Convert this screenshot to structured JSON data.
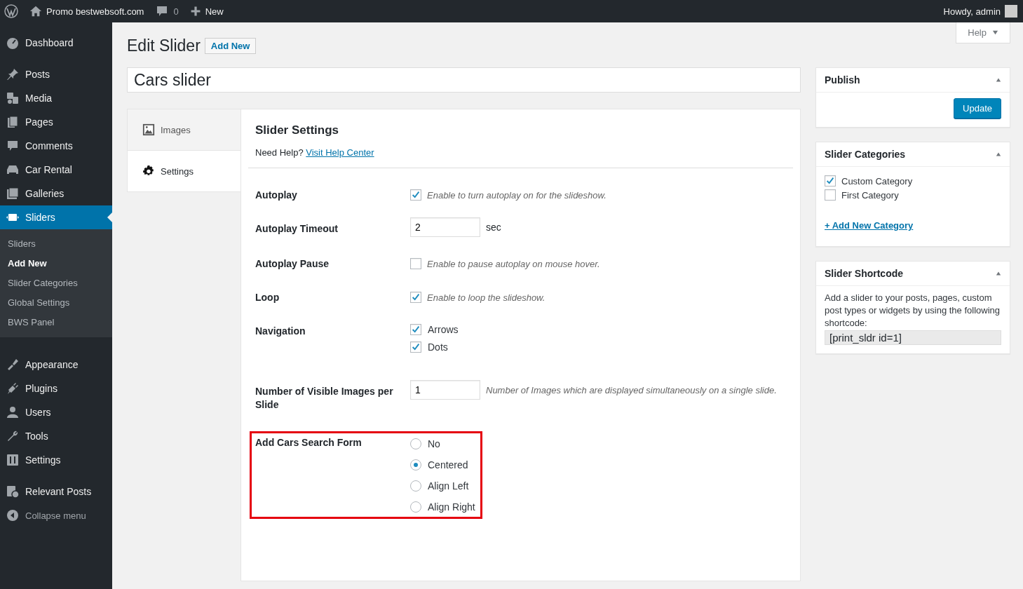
{
  "admin_bar": {
    "site_name": "Promo bestwebsoft.com",
    "comments_count": "0",
    "new_label": "New",
    "greeting": "Howdy, admin"
  },
  "sidebar": {
    "items": [
      {
        "label": "Dashboard",
        "kind": "dashboard",
        "selected": false
      },
      {
        "label": "Posts",
        "kind": "posts",
        "selected": false
      },
      {
        "label": "Media",
        "kind": "media",
        "selected": false
      },
      {
        "label": "Pages",
        "kind": "pages",
        "selected": false
      },
      {
        "label": "Comments",
        "kind": "comments",
        "selected": false
      },
      {
        "label": "Car Rental",
        "kind": "car",
        "selected": false
      },
      {
        "label": "Galleries",
        "kind": "gallery",
        "selected": false
      },
      {
        "label": "Sliders",
        "kind": "slider",
        "selected": true
      },
      {
        "label": "Appearance",
        "kind": "appearance",
        "selected": false
      },
      {
        "label": "Plugins",
        "kind": "plugins",
        "selected": false
      },
      {
        "label": "Users",
        "kind": "users",
        "selected": false
      },
      {
        "label": "Tools",
        "kind": "tools",
        "selected": false
      },
      {
        "label": "Settings",
        "kind": "settings",
        "selected": false
      },
      {
        "label": "Relevant Posts",
        "kind": "relevant",
        "selected": false
      }
    ],
    "submenu": [
      {
        "label": "Sliders",
        "selected": false
      },
      {
        "label": "Add New",
        "selected": true
      },
      {
        "label": "Slider Categories",
        "selected": false
      },
      {
        "label": "Global Settings",
        "selected": false
      },
      {
        "label": "BWS Panel",
        "selected": false
      }
    ],
    "collapse_label": "Collapse menu"
  },
  "help_button": "Help",
  "page": {
    "title": "Edit Slider",
    "add_new": "Add New",
    "slider_title": "Cars slider"
  },
  "tabs": [
    {
      "label": "Images",
      "kind": "images",
      "selected": false
    },
    {
      "label": "Settings",
      "kind": "settings",
      "selected": true
    }
  ],
  "settings": {
    "title": "Slider Settings",
    "help_prefix": "Need Help?",
    "help_link": "Visit Help Center",
    "rows": [
      {
        "kind": "checkbox",
        "label": "Autoplay",
        "checked": true,
        "description": "Enable to turn autoplay on for the slideshow."
      },
      {
        "kind": "number",
        "label": "Autoplay Timeout",
        "value": "2",
        "unit": "sec"
      },
      {
        "kind": "checkbox",
        "label": "Autoplay Pause",
        "checked": false,
        "description": "Enable to pause autoplay on mouse hover."
      },
      {
        "kind": "checkbox",
        "label": "Loop",
        "checked": true,
        "description": "Enable to loop the slideshow."
      },
      {
        "kind": "checkboxes",
        "label": "Navigation",
        "options": [
          {
            "label": "Arrows",
            "checked": true
          },
          {
            "label": "Dots",
            "checked": true
          }
        ]
      },
      {
        "kind": "number",
        "label": "Number of Visible Images per Slide",
        "value": "1",
        "description": "Number of Images which are displayed simultaneously on a single slide."
      },
      {
        "kind": "radio",
        "label": "Add Cars Search Form",
        "highlighted": true,
        "options": [
          {
            "label": "No",
            "selected": false
          },
          {
            "label": "Centered",
            "selected": true
          },
          {
            "label": "Align Left",
            "selected": false
          },
          {
            "label": "Align Right",
            "selected": false
          }
        ]
      }
    ]
  },
  "publish": {
    "title": "Publish",
    "button": "Update"
  },
  "categories": {
    "title": "Slider Categories",
    "items": [
      {
        "label": "Custom Category",
        "checked": true
      },
      {
        "label": "First Category",
        "checked": false
      }
    ],
    "add_link": "+ Add New Category"
  },
  "shortcode": {
    "title": "Slider Shortcode",
    "description": "Add a slider to your posts, pages, custom post types or widgets by using the following shortcode:",
    "code": "[print_sldr id=1]"
  }
}
